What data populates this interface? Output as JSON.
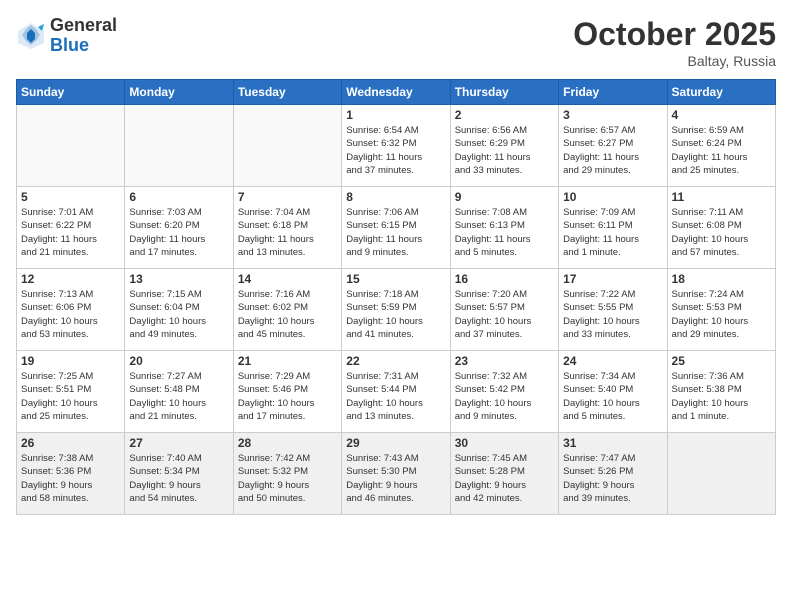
{
  "logo": {
    "general": "General",
    "blue": "Blue"
  },
  "header": {
    "month": "October 2025",
    "location": "Baltay, Russia"
  },
  "weekdays": [
    "Sunday",
    "Monday",
    "Tuesday",
    "Wednesday",
    "Thursday",
    "Friday",
    "Saturday"
  ],
  "weeks": [
    [
      {
        "day": "",
        "info": ""
      },
      {
        "day": "",
        "info": ""
      },
      {
        "day": "",
        "info": ""
      },
      {
        "day": "1",
        "info": "Sunrise: 6:54 AM\nSunset: 6:32 PM\nDaylight: 11 hours\nand 37 minutes."
      },
      {
        "day": "2",
        "info": "Sunrise: 6:56 AM\nSunset: 6:29 PM\nDaylight: 11 hours\nand 33 minutes."
      },
      {
        "day": "3",
        "info": "Sunrise: 6:57 AM\nSunset: 6:27 PM\nDaylight: 11 hours\nand 29 minutes."
      },
      {
        "day": "4",
        "info": "Sunrise: 6:59 AM\nSunset: 6:24 PM\nDaylight: 11 hours\nand 25 minutes."
      }
    ],
    [
      {
        "day": "5",
        "info": "Sunrise: 7:01 AM\nSunset: 6:22 PM\nDaylight: 11 hours\nand 21 minutes."
      },
      {
        "day": "6",
        "info": "Sunrise: 7:03 AM\nSunset: 6:20 PM\nDaylight: 11 hours\nand 17 minutes."
      },
      {
        "day": "7",
        "info": "Sunrise: 7:04 AM\nSunset: 6:18 PM\nDaylight: 11 hours\nand 13 minutes."
      },
      {
        "day": "8",
        "info": "Sunrise: 7:06 AM\nSunset: 6:15 PM\nDaylight: 11 hours\nand 9 minutes."
      },
      {
        "day": "9",
        "info": "Sunrise: 7:08 AM\nSunset: 6:13 PM\nDaylight: 11 hours\nand 5 minutes."
      },
      {
        "day": "10",
        "info": "Sunrise: 7:09 AM\nSunset: 6:11 PM\nDaylight: 11 hours\nand 1 minute."
      },
      {
        "day": "11",
        "info": "Sunrise: 7:11 AM\nSunset: 6:08 PM\nDaylight: 10 hours\nand 57 minutes."
      }
    ],
    [
      {
        "day": "12",
        "info": "Sunrise: 7:13 AM\nSunset: 6:06 PM\nDaylight: 10 hours\nand 53 minutes."
      },
      {
        "day": "13",
        "info": "Sunrise: 7:15 AM\nSunset: 6:04 PM\nDaylight: 10 hours\nand 49 minutes."
      },
      {
        "day": "14",
        "info": "Sunrise: 7:16 AM\nSunset: 6:02 PM\nDaylight: 10 hours\nand 45 minutes."
      },
      {
        "day": "15",
        "info": "Sunrise: 7:18 AM\nSunset: 5:59 PM\nDaylight: 10 hours\nand 41 minutes."
      },
      {
        "day": "16",
        "info": "Sunrise: 7:20 AM\nSunset: 5:57 PM\nDaylight: 10 hours\nand 37 minutes."
      },
      {
        "day": "17",
        "info": "Sunrise: 7:22 AM\nSunset: 5:55 PM\nDaylight: 10 hours\nand 33 minutes."
      },
      {
        "day": "18",
        "info": "Sunrise: 7:24 AM\nSunset: 5:53 PM\nDaylight: 10 hours\nand 29 minutes."
      }
    ],
    [
      {
        "day": "19",
        "info": "Sunrise: 7:25 AM\nSunset: 5:51 PM\nDaylight: 10 hours\nand 25 minutes."
      },
      {
        "day": "20",
        "info": "Sunrise: 7:27 AM\nSunset: 5:48 PM\nDaylight: 10 hours\nand 21 minutes."
      },
      {
        "day": "21",
        "info": "Sunrise: 7:29 AM\nSunset: 5:46 PM\nDaylight: 10 hours\nand 17 minutes."
      },
      {
        "day": "22",
        "info": "Sunrise: 7:31 AM\nSunset: 5:44 PM\nDaylight: 10 hours\nand 13 minutes."
      },
      {
        "day": "23",
        "info": "Sunrise: 7:32 AM\nSunset: 5:42 PM\nDaylight: 10 hours\nand 9 minutes."
      },
      {
        "day": "24",
        "info": "Sunrise: 7:34 AM\nSunset: 5:40 PM\nDaylight: 10 hours\nand 5 minutes."
      },
      {
        "day": "25",
        "info": "Sunrise: 7:36 AM\nSunset: 5:38 PM\nDaylight: 10 hours\nand 1 minute."
      }
    ],
    [
      {
        "day": "26",
        "info": "Sunrise: 7:38 AM\nSunset: 5:36 PM\nDaylight: 9 hours\nand 58 minutes."
      },
      {
        "day": "27",
        "info": "Sunrise: 7:40 AM\nSunset: 5:34 PM\nDaylight: 9 hours\nand 54 minutes."
      },
      {
        "day": "28",
        "info": "Sunrise: 7:42 AM\nSunset: 5:32 PM\nDaylight: 9 hours\nand 50 minutes."
      },
      {
        "day": "29",
        "info": "Sunrise: 7:43 AM\nSunset: 5:30 PM\nDaylight: 9 hours\nand 46 minutes."
      },
      {
        "day": "30",
        "info": "Sunrise: 7:45 AM\nSunset: 5:28 PM\nDaylight: 9 hours\nand 42 minutes."
      },
      {
        "day": "31",
        "info": "Sunrise: 7:47 AM\nSunset: 5:26 PM\nDaylight: 9 hours\nand 39 minutes."
      },
      {
        "day": "",
        "info": ""
      }
    ]
  ]
}
